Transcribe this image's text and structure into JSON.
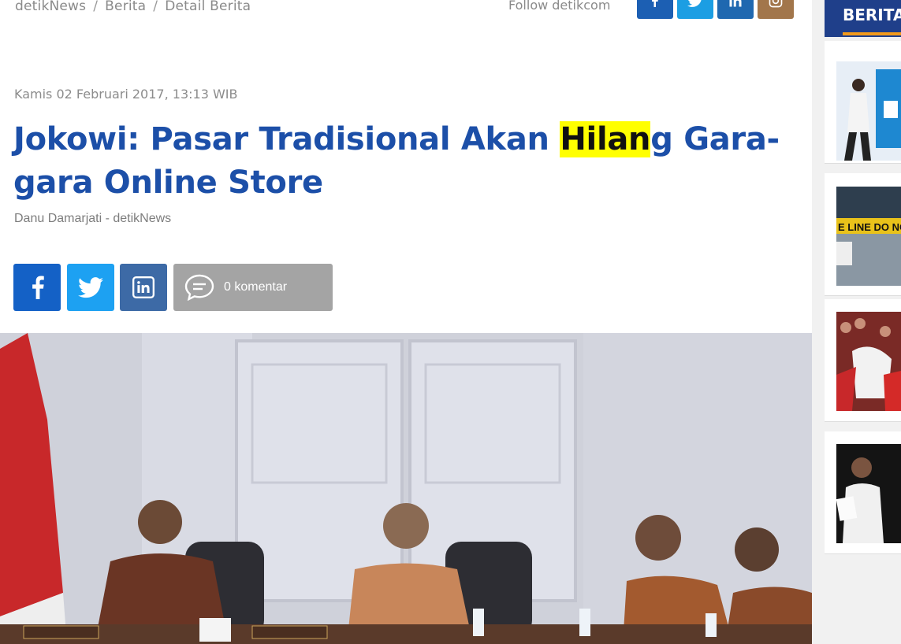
{
  "breadcrumb": {
    "items": [
      "detikNews",
      "Berita",
      "Detail Berita"
    ],
    "separator": "/"
  },
  "follow": {
    "label": "Follow detikcom",
    "buttons": [
      {
        "icon": "facebook-icon",
        "color": "#1c5fb3"
      },
      {
        "icon": "twitter-icon",
        "color": "#1c9ee3"
      },
      {
        "icon": "linkedin-icon",
        "color": "#1f68b0"
      },
      {
        "icon": "instagram-icon",
        "color": "#a2764b"
      }
    ]
  },
  "article": {
    "date": "Kamis 02 Februari 2017, 13:13 WIB",
    "title_before": "Jokowi: Pasar Tradisional Akan ",
    "title_highlight": "Hilan",
    "title_after": "g Gara-gara Online Store",
    "author": "Danu Damarjati - detikNews"
  },
  "share": {
    "facebook": {
      "icon": "facebook-icon",
      "color": "#1461c6"
    },
    "twitter": {
      "icon": "twitter-icon",
      "color": "#1da1f2"
    },
    "linkedin": {
      "icon": "linkedin-icon",
      "color": "#3d6aa6"
    },
    "comment_label": "0 komentar",
    "comment_icon": "comment-bubble-icon"
  },
  "sidebar": {
    "heading": "BERITA",
    "card_banner_text": "E LINE DO NOT"
  },
  "colors": {
    "title": "#1c4fa8",
    "highlight": "#ffff00",
    "sidebar_accent": "#f29a1b",
    "sidebar_head": "#1f3f8a"
  }
}
